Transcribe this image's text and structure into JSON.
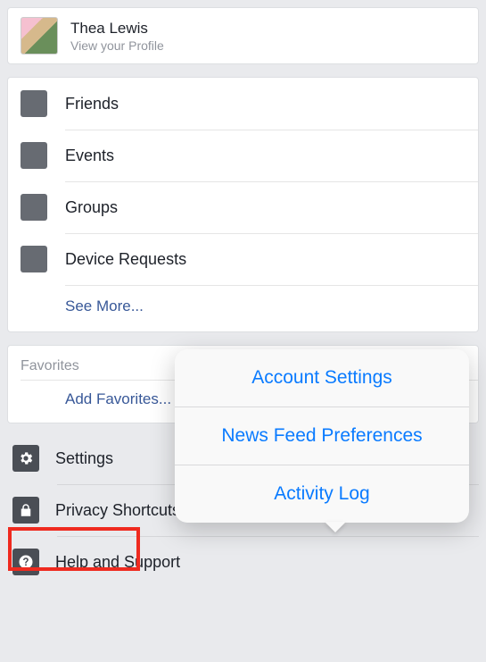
{
  "profile": {
    "name": "Thea Lewis",
    "subtitle": "View your Profile"
  },
  "nav": {
    "items": [
      {
        "label": "Friends"
      },
      {
        "label": "Events"
      },
      {
        "label": "Groups"
      },
      {
        "label": "Device Requests"
      }
    ],
    "see_more": "See More..."
  },
  "favorites": {
    "header": "Favorites",
    "add": "Add Favorites..."
  },
  "settings_list": {
    "items": [
      {
        "label": "Settings",
        "icon": "gear-icon"
      },
      {
        "label": "Privacy Shortcuts",
        "icon": "lock-icon"
      },
      {
        "label": "Help and Support",
        "icon": "help-icon"
      }
    ]
  },
  "popover": {
    "items": [
      {
        "label": "Account Settings"
      },
      {
        "label": "News Feed Preferences"
      },
      {
        "label": "Activity Log"
      }
    ]
  }
}
